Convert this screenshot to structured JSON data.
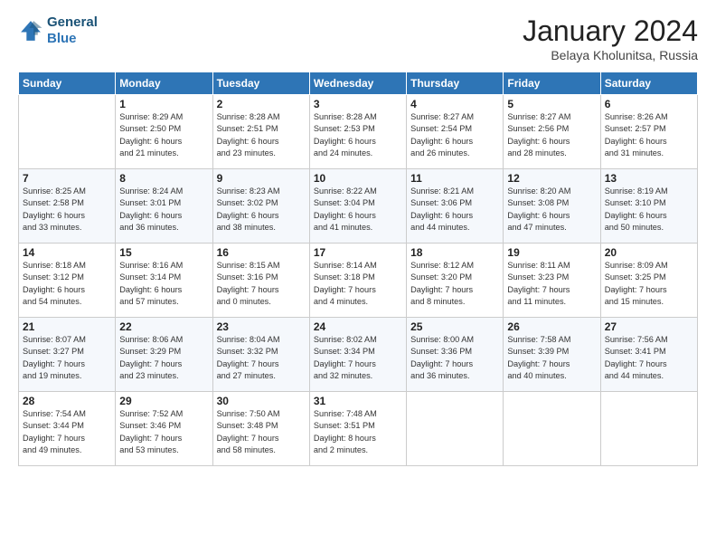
{
  "header": {
    "logo_line1": "General",
    "logo_line2": "Blue",
    "month_title": "January 2024",
    "location": "Belaya Kholunitsa, Russia"
  },
  "weekdays": [
    "Sunday",
    "Monday",
    "Tuesday",
    "Wednesday",
    "Thursday",
    "Friday",
    "Saturday"
  ],
  "weeks": [
    [
      {
        "day": "",
        "info": ""
      },
      {
        "day": "1",
        "info": "Sunrise: 8:29 AM\nSunset: 2:50 PM\nDaylight: 6 hours\nand 21 minutes."
      },
      {
        "day": "2",
        "info": "Sunrise: 8:28 AM\nSunset: 2:51 PM\nDaylight: 6 hours\nand 23 minutes."
      },
      {
        "day": "3",
        "info": "Sunrise: 8:28 AM\nSunset: 2:53 PM\nDaylight: 6 hours\nand 24 minutes."
      },
      {
        "day": "4",
        "info": "Sunrise: 8:27 AM\nSunset: 2:54 PM\nDaylight: 6 hours\nand 26 minutes."
      },
      {
        "day": "5",
        "info": "Sunrise: 8:27 AM\nSunset: 2:56 PM\nDaylight: 6 hours\nand 28 minutes."
      },
      {
        "day": "6",
        "info": "Sunrise: 8:26 AM\nSunset: 2:57 PM\nDaylight: 6 hours\nand 31 minutes."
      }
    ],
    [
      {
        "day": "7",
        "info": "Sunrise: 8:25 AM\nSunset: 2:58 PM\nDaylight: 6 hours\nand 33 minutes."
      },
      {
        "day": "8",
        "info": "Sunrise: 8:24 AM\nSunset: 3:01 PM\nDaylight: 6 hours\nand 36 minutes."
      },
      {
        "day": "9",
        "info": "Sunrise: 8:23 AM\nSunset: 3:02 PM\nDaylight: 6 hours\nand 38 minutes."
      },
      {
        "day": "10",
        "info": "Sunrise: 8:22 AM\nSunset: 3:04 PM\nDaylight: 6 hours\nand 41 minutes."
      },
      {
        "day": "11",
        "info": "Sunrise: 8:21 AM\nSunset: 3:06 PM\nDaylight: 6 hours\nand 44 minutes."
      },
      {
        "day": "12",
        "info": "Sunrise: 8:20 AM\nSunset: 3:08 PM\nDaylight: 6 hours\nand 47 minutes."
      },
      {
        "day": "13",
        "info": "Sunrise: 8:19 AM\nSunset: 3:10 PM\nDaylight: 6 hours\nand 50 minutes."
      }
    ],
    [
      {
        "day": "14",
        "info": "Sunrise: 8:18 AM\nSunset: 3:12 PM\nDaylight: 6 hours\nand 54 minutes."
      },
      {
        "day": "15",
        "info": "Sunrise: 8:16 AM\nSunset: 3:14 PM\nDaylight: 6 hours\nand 57 minutes."
      },
      {
        "day": "16",
        "info": "Sunrise: 8:15 AM\nSunset: 3:16 PM\nDaylight: 7 hours\nand 0 minutes."
      },
      {
        "day": "17",
        "info": "Sunrise: 8:14 AM\nSunset: 3:18 PM\nDaylight: 7 hours\nand 4 minutes."
      },
      {
        "day": "18",
        "info": "Sunrise: 8:12 AM\nSunset: 3:20 PM\nDaylight: 7 hours\nand 8 minutes."
      },
      {
        "day": "19",
        "info": "Sunrise: 8:11 AM\nSunset: 3:23 PM\nDaylight: 7 hours\nand 11 minutes."
      },
      {
        "day": "20",
        "info": "Sunrise: 8:09 AM\nSunset: 3:25 PM\nDaylight: 7 hours\nand 15 minutes."
      }
    ],
    [
      {
        "day": "21",
        "info": "Sunrise: 8:07 AM\nSunset: 3:27 PM\nDaylight: 7 hours\nand 19 minutes."
      },
      {
        "day": "22",
        "info": "Sunrise: 8:06 AM\nSunset: 3:29 PM\nDaylight: 7 hours\nand 23 minutes."
      },
      {
        "day": "23",
        "info": "Sunrise: 8:04 AM\nSunset: 3:32 PM\nDaylight: 7 hours\nand 27 minutes."
      },
      {
        "day": "24",
        "info": "Sunrise: 8:02 AM\nSunset: 3:34 PM\nDaylight: 7 hours\nand 32 minutes."
      },
      {
        "day": "25",
        "info": "Sunrise: 8:00 AM\nSunset: 3:36 PM\nDaylight: 7 hours\nand 36 minutes."
      },
      {
        "day": "26",
        "info": "Sunrise: 7:58 AM\nSunset: 3:39 PM\nDaylight: 7 hours\nand 40 minutes."
      },
      {
        "day": "27",
        "info": "Sunrise: 7:56 AM\nSunset: 3:41 PM\nDaylight: 7 hours\nand 44 minutes."
      }
    ],
    [
      {
        "day": "28",
        "info": "Sunrise: 7:54 AM\nSunset: 3:44 PM\nDaylight: 7 hours\nand 49 minutes."
      },
      {
        "day": "29",
        "info": "Sunrise: 7:52 AM\nSunset: 3:46 PM\nDaylight: 7 hours\nand 53 minutes."
      },
      {
        "day": "30",
        "info": "Sunrise: 7:50 AM\nSunset: 3:48 PM\nDaylight: 7 hours\nand 58 minutes."
      },
      {
        "day": "31",
        "info": "Sunrise: 7:48 AM\nSunset: 3:51 PM\nDaylight: 8 hours\nand 2 minutes."
      },
      {
        "day": "",
        "info": ""
      },
      {
        "day": "",
        "info": ""
      },
      {
        "day": "",
        "info": ""
      }
    ]
  ]
}
